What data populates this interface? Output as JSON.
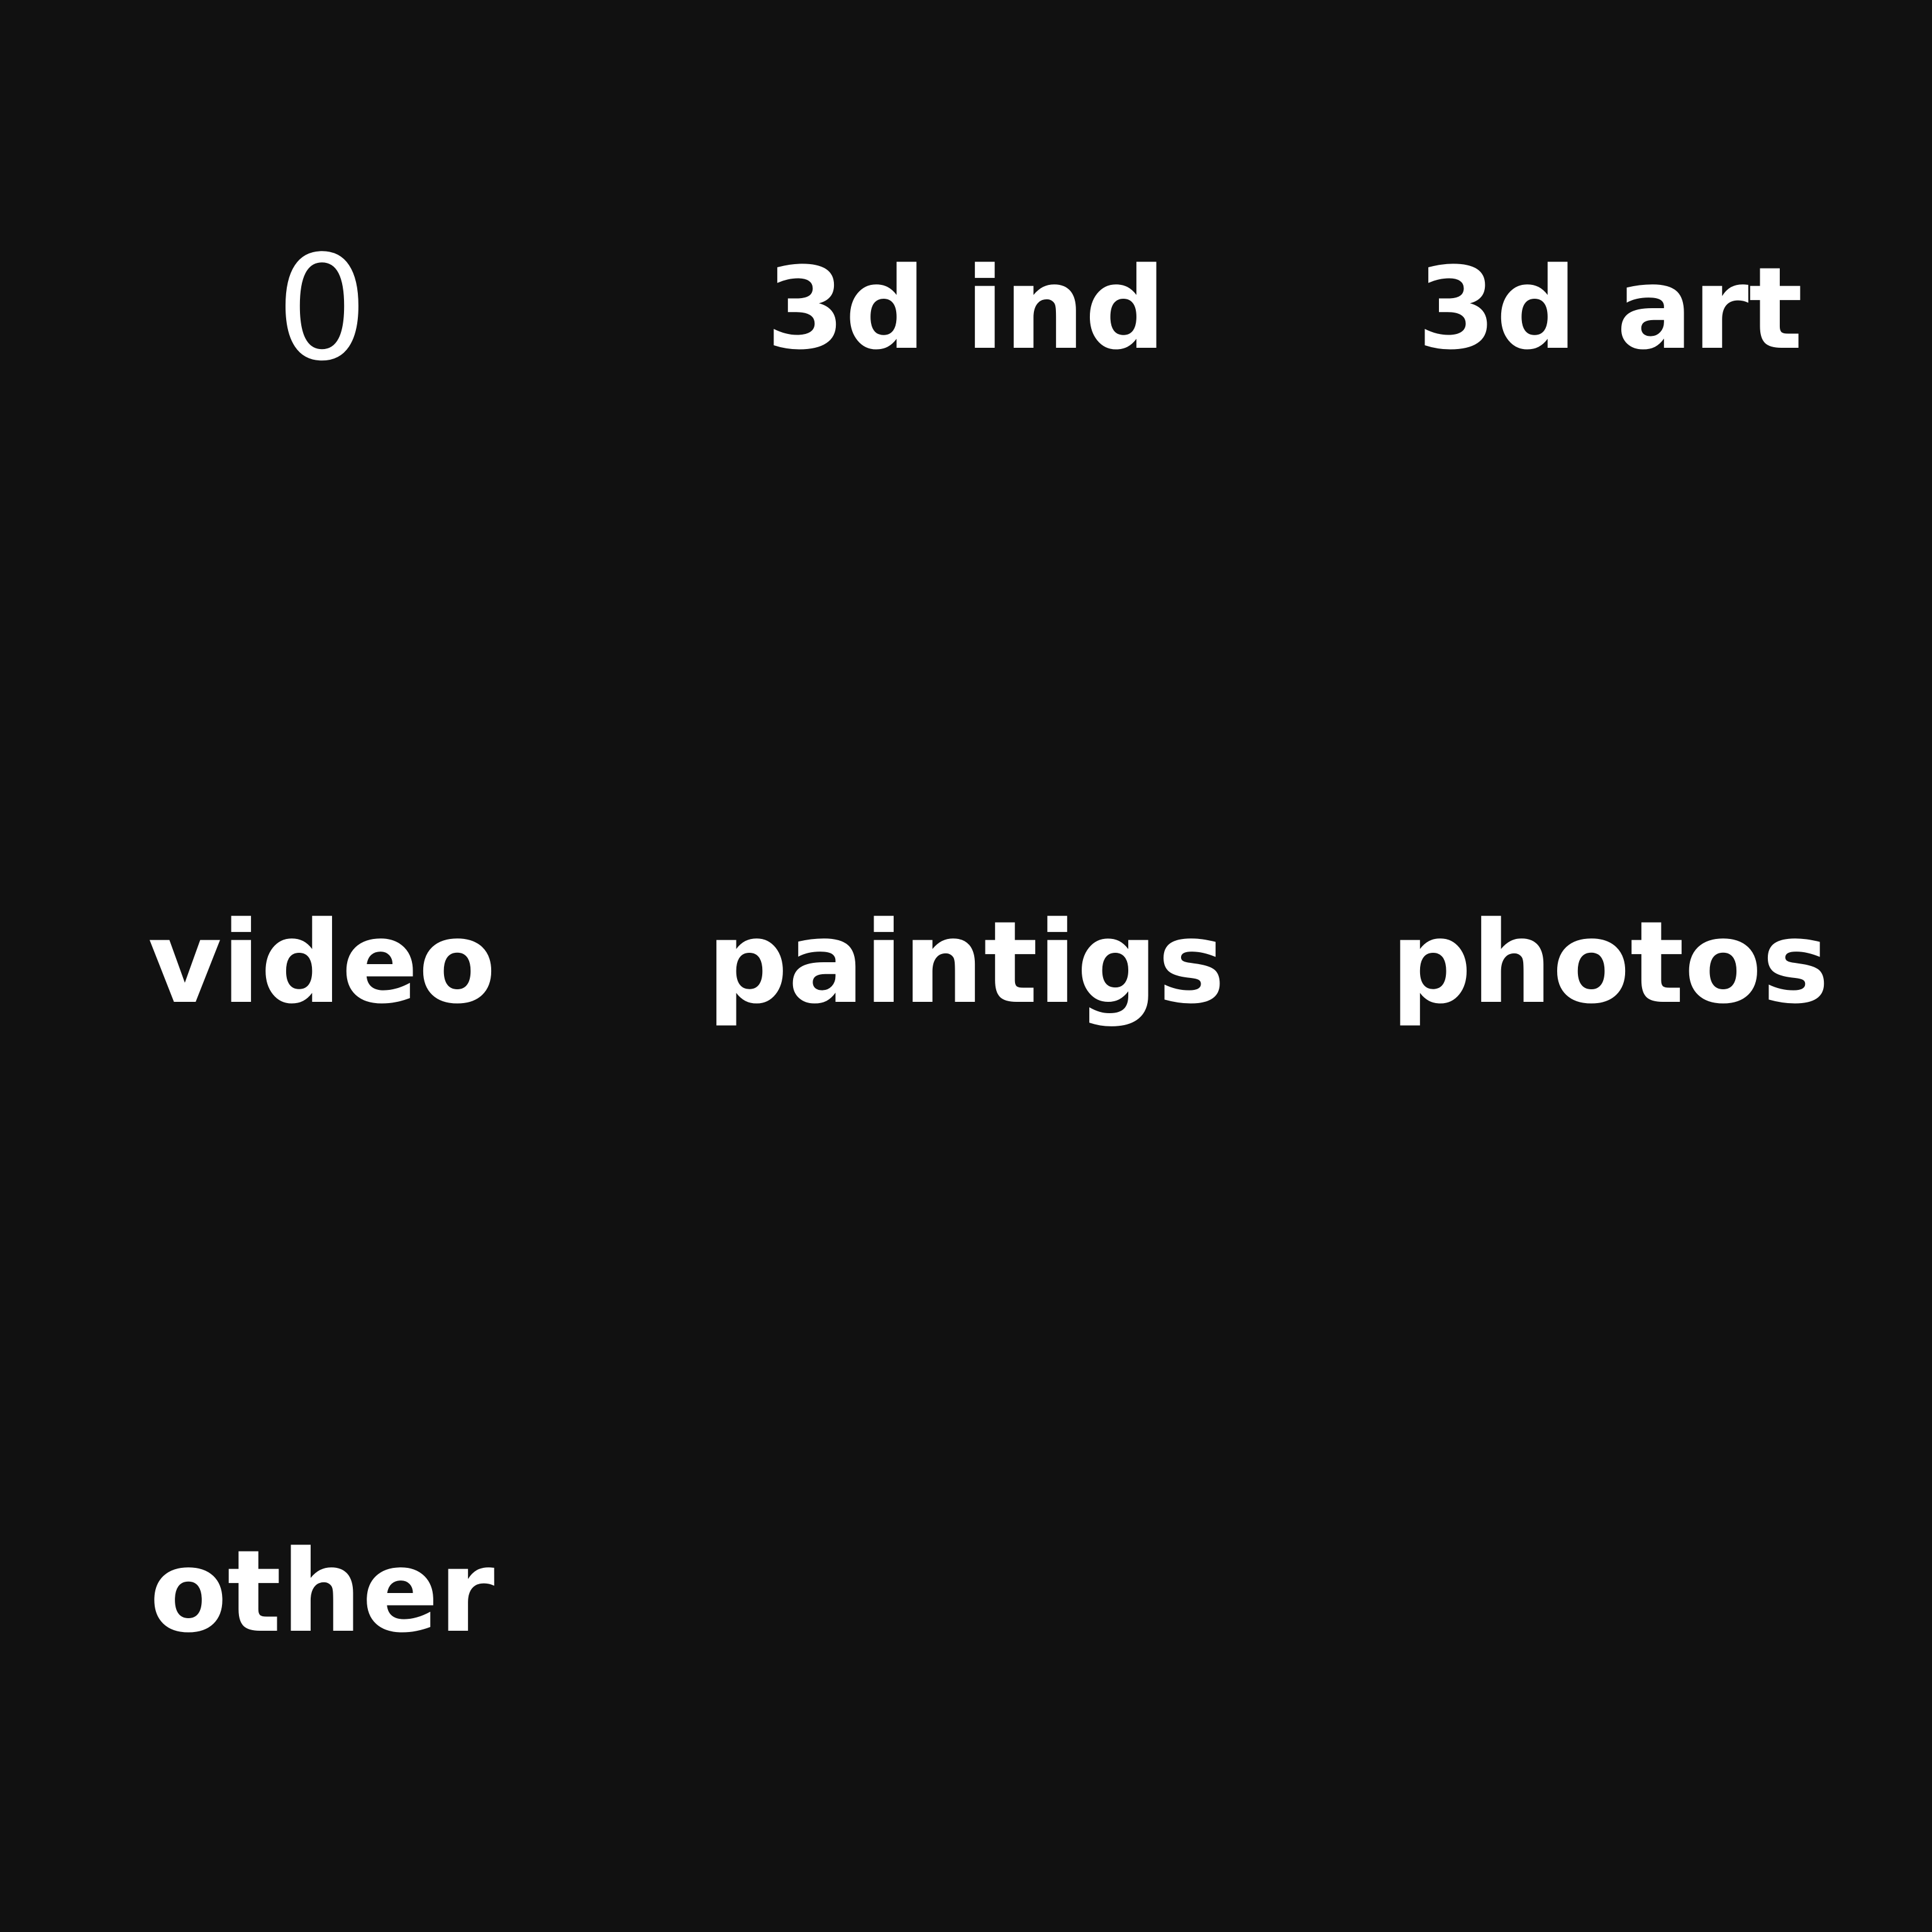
{
  "counter": {
    "label": "0"
  },
  "categories": [
    {
      "label": "3d ind"
    },
    {
      "label": "3d art"
    },
    {
      "label": "video"
    },
    {
      "label": "paintigs"
    },
    {
      "label": "photos"
    },
    {
      "label": "other"
    }
  ],
  "colors": {
    "background": "#111111",
    "text": "#ffffff"
  }
}
